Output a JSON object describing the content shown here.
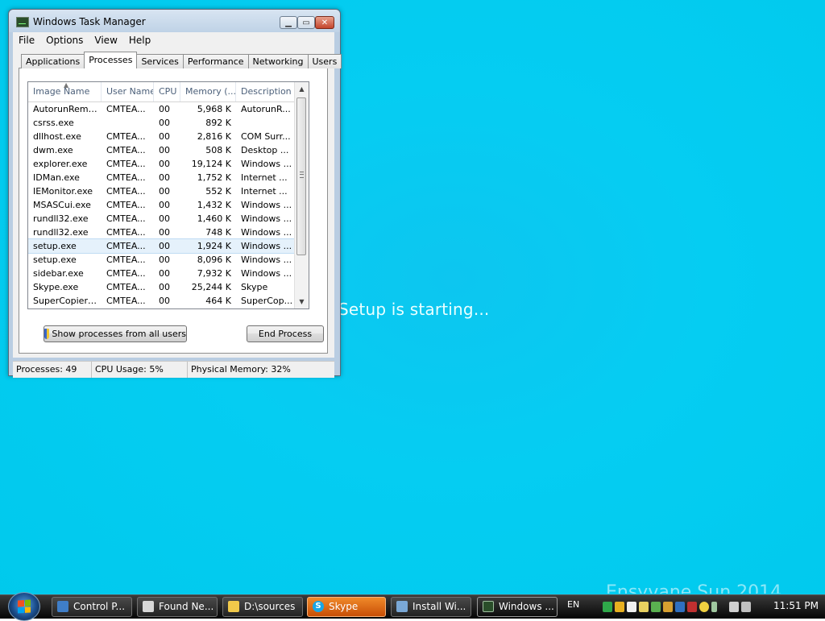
{
  "desktop": {
    "setup_text": "Setup is starting...",
    "watermark_text": "Ensyvane Sun 2014"
  },
  "window": {
    "title": "Windows Task Manager",
    "buttons": {
      "minimize": "▁",
      "maximize": "▭",
      "close": "✕"
    },
    "menu": [
      "File",
      "Options",
      "View",
      "Help"
    ],
    "tabs": [
      "Applications",
      "Processes",
      "Services",
      "Performance",
      "Networking",
      "Users"
    ],
    "active_tab": "Processes"
  },
  "process_list": {
    "columns": [
      "Image Name",
      "User Name",
      "CPU",
      "Memory (...",
      "Description"
    ],
    "sort_column": "Image Name",
    "rows": [
      [
        "AutorunRemo...",
        "CMTEA...",
        "00",
        "5,968 K",
        "AutorunR..."
      ],
      [
        "csrss.exe",
        "",
        "00",
        "892 K",
        ""
      ],
      [
        "dllhost.exe",
        "CMTEA...",
        "00",
        "2,816 K",
        "COM Surr..."
      ],
      [
        "dwm.exe",
        "CMTEA...",
        "00",
        "508 K",
        "Desktop ..."
      ],
      [
        "explorer.exe",
        "CMTEA...",
        "00",
        "19,124 K",
        "Windows ..."
      ],
      [
        "IDMan.exe",
        "CMTEA...",
        "00",
        "1,752 K",
        "Internet ..."
      ],
      [
        "IEMonitor.exe",
        "CMTEA...",
        "00",
        "552 K",
        "Internet ..."
      ],
      [
        "MSASCui.exe",
        "CMTEA...",
        "00",
        "1,432 K",
        "Windows ..."
      ],
      [
        "rundll32.exe",
        "CMTEA...",
        "00",
        "1,460 K",
        "Windows ..."
      ],
      [
        "rundll32.exe",
        "CMTEA...",
        "00",
        "748 K",
        "Windows ..."
      ],
      [
        "setup.exe",
        "CMTEA...",
        "00",
        "1,924 K",
        "Windows ..."
      ],
      [
        "setup.exe",
        "CMTEA...",
        "00",
        "8,096 K",
        "Windows ..."
      ],
      [
        "sidebar.exe",
        "CMTEA...",
        "00",
        "7,932 K",
        "Windows ..."
      ],
      [
        "Skype.exe",
        "CMTEA...",
        "00",
        "25,244 K",
        "Skype"
      ],
      [
        "SuperCopier2...",
        "CMTEA...",
        "00",
        "464 K",
        "SuperCop..."
      ]
    ],
    "selected_row": 10
  },
  "buttons": {
    "show_all": "Show processes from all users",
    "end_process": "End Process"
  },
  "status": {
    "processes": "Processes: 49",
    "cpu": "CPU Usage: 5%",
    "memory": "Physical Memory: 32%"
  },
  "taskbar": {
    "items": [
      {
        "label": "Control P...",
        "icon": "control-panel-icon"
      },
      {
        "label": "Found Ne...",
        "icon": "found-new-hardware-icon"
      },
      {
        "label": "D:\\sources",
        "icon": "folder-icon"
      },
      {
        "label": "Skype",
        "icon": "skype-icon"
      },
      {
        "label": "Install Wi...",
        "icon": "installer-icon"
      },
      {
        "label": "Windows ...",
        "icon": "task-manager-icon"
      }
    ],
    "language": "EN",
    "clock": "11:51 PM"
  }
}
